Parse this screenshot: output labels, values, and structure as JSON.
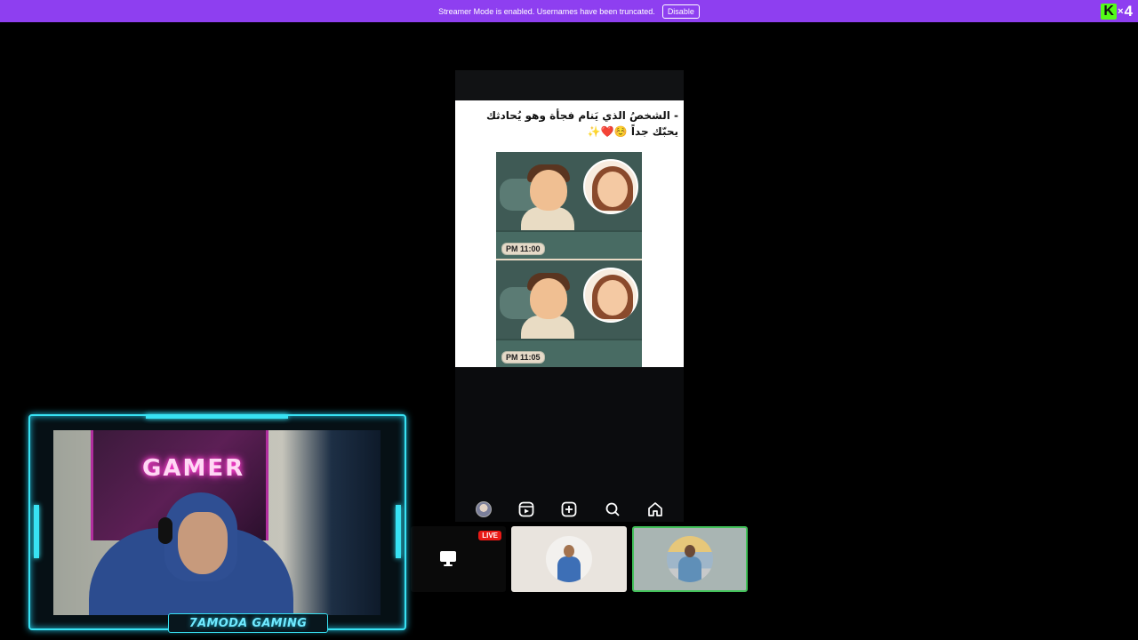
{
  "banner": {
    "message": "Streamer Mode is enabled. Usernames have been truncated.",
    "button_label": "Disable",
    "background": "#8e3ff0"
  },
  "logo": {
    "letter": "K",
    "multiplier": "×",
    "count": "4"
  },
  "post": {
    "caption": "- الشخصُ الذي يَنام فجأة وهو يُحادثك يحبّك جداً ☺️❤️✨",
    "comic": {
      "panel_1_time": "PM 11:00",
      "panel_2_time": "PM 11:05"
    }
  },
  "phone_nav": {
    "icons": [
      "profile-avatar-icon",
      "reels-icon",
      "create-post-icon",
      "search-icon",
      "home-icon"
    ]
  },
  "tiles": {
    "screen_share": {
      "badge": "LIVE",
      "icon": "monitor-icon"
    },
    "participant_2": {
      "avatar": "avatar"
    },
    "participant_3": {
      "avatar": "avatar",
      "active": true,
      "highlight": "#43c15a"
    }
  },
  "webcam": {
    "name_plate": "7AMODA GAMING",
    "poster_text": "GAMER",
    "accent": "#38e2f3"
  }
}
